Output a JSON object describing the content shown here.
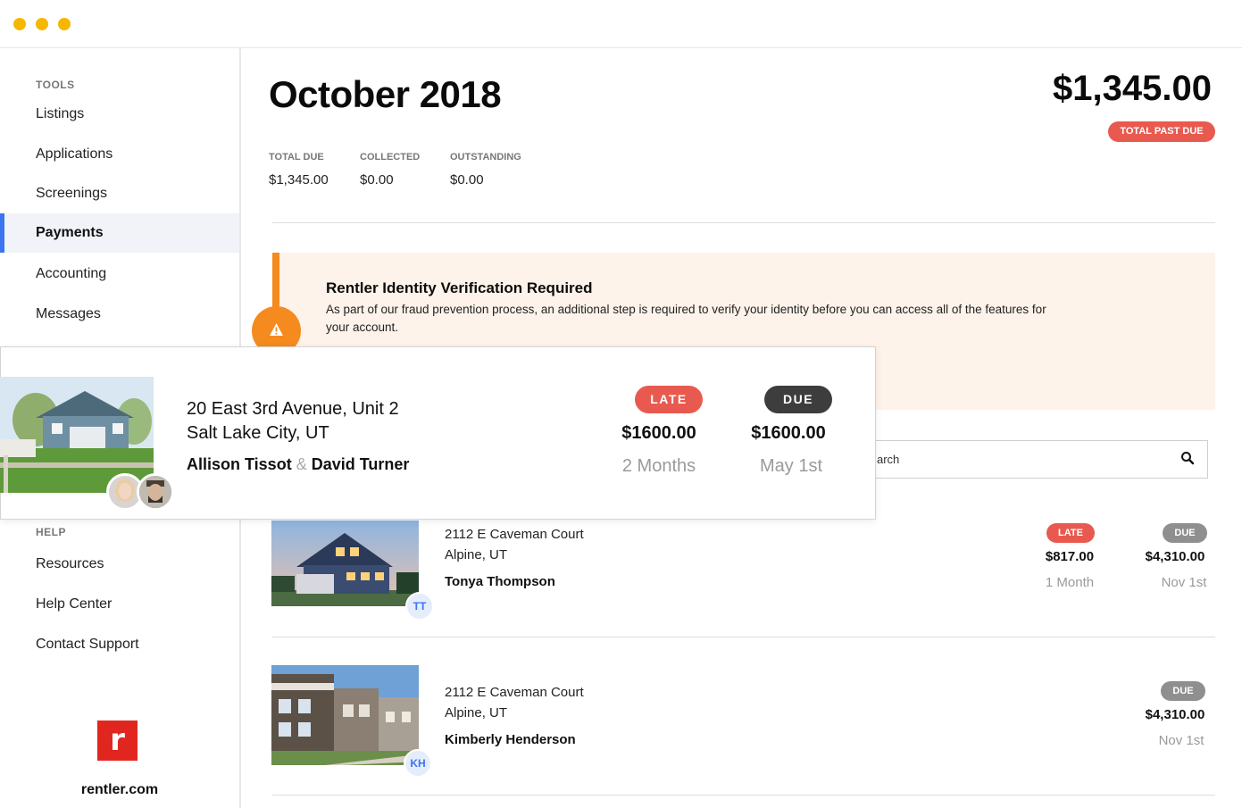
{
  "window": {
    "dots": [
      "#f5b700",
      "#f5b700",
      "#f5b700"
    ]
  },
  "sidebar": {
    "tools_heading": "TOOLS",
    "items": [
      {
        "label": "Listings"
      },
      {
        "label": "Applications"
      },
      {
        "label": "Screenings"
      },
      {
        "label": "Payments",
        "active": true
      },
      {
        "label": "Accounting"
      },
      {
        "label": "Messages"
      }
    ],
    "help_heading": "HELP",
    "help_items": [
      {
        "label": "Resources"
      },
      {
        "label": "Help Center"
      },
      {
        "label": "Contact Support"
      }
    ],
    "logo_letter": "r",
    "logo_text": "rentler.com"
  },
  "header": {
    "title": "October 2018",
    "total_amount": "$1,345.00",
    "past_due_badge": "TOTAL PAST DUE",
    "stats": [
      {
        "label": "TOTAL DUE",
        "value": "$1,345.00"
      },
      {
        "label": "COLLECTED",
        "value": "$0.00"
      },
      {
        "label": "OUTSTANDING",
        "value": "$0.00"
      }
    ]
  },
  "alert": {
    "title": "Rentler Identity Verification Required",
    "text": "As part of our fraud prevention process, an additional step is required to verify your identity before you can access all of the features for your account."
  },
  "search": {
    "visible_text": "arch"
  },
  "featured": {
    "address_line1": "20 East 3rd Avenue, Unit 2",
    "address_line2": "Salt Lake City, UT",
    "tenant1": "Allison Tissot",
    "amp": "&",
    "tenant2": "David Turner",
    "late_badge": "LATE",
    "late_amount": "$1600.00",
    "late_sub": "2 Months",
    "due_badge": "DUE",
    "due_amount": "$1600.00",
    "due_sub": "May 1st"
  },
  "rows": [
    {
      "address_line1": "2112 E Caveman Court",
      "address_line2": "Alpine, UT",
      "tenant": "Tonya Thompson",
      "initials": "TT",
      "late_badge": "LATE",
      "late_amount": "$817.00",
      "late_sub": "1 Month",
      "due_badge": "DUE",
      "due_amount": "$4,310.00",
      "due_sub": "Nov 1st"
    },
    {
      "address_line1": "2112 E Caveman Court",
      "address_line2": "Alpine, UT",
      "tenant": "Kimberly Henderson",
      "initials": "KH",
      "due_badge": "DUE",
      "due_amount": "$4,310.00",
      "due_sub": "Nov 1st"
    }
  ],
  "colors": {
    "late": "#e85a4f",
    "due_dark": "#3d3d3d",
    "due_gray": "#8f8f8f",
    "accent_blue": "#3b74f0",
    "alert_orange": "#f58a1f",
    "alert_bg": "#fdf3ea",
    "brand_red": "#e0261f"
  },
  "icons": [
    "warning-icon",
    "search-icon"
  ]
}
